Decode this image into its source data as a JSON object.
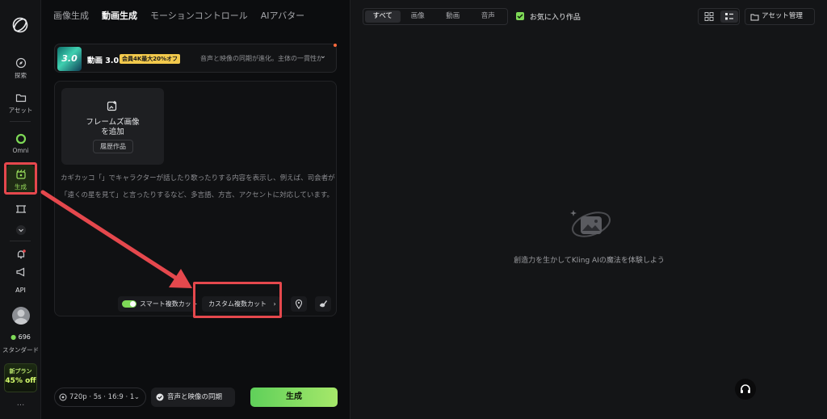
{
  "rail": {
    "items": [
      {
        "label": "探索"
      },
      {
        "label": "アセット"
      },
      {
        "label": "Omni"
      },
      {
        "label": "生成"
      },
      {
        "label": "API"
      }
    ],
    "credits": "696",
    "plan": "スタンダード",
    "promo_line1": "新プラン",
    "promo_line2": "45% off",
    "more": "..."
  },
  "top_nav": {
    "tabs": [
      "画像生成",
      "動画生成",
      "モーションコントロール",
      "AIアバター"
    ],
    "active": "動画生成"
  },
  "model": {
    "thumb_text": "3.0",
    "name": "動画 3.0",
    "badge": "会員4K最大20%オフ",
    "description": "音声と映像の同期が進化。主体の一貫性が...",
    "accent_color": "#f2c94c"
  },
  "frame": {
    "title_line1": "フレームズ画像",
    "title_line2": "を追加",
    "history_label": "履歴作品"
  },
  "prompt": {
    "placeholder": "カギカッコ「」でキャラクターが話したり歌ったりする内容を表示し、例えば、司会者が「遠くの星を見て」と言ったりするなど、多言語、方言、アクセントに対応しています。"
  },
  "controls": {
    "smart_multicut": "スマート複数カット",
    "custom_multicut": "カスタム複数カット",
    "custom_chevron": "›"
  },
  "bottom": {
    "settings": "720p · 5s · 16:9 · 1",
    "sync": "音声と映像の同期",
    "generate": "生成",
    "generate_color": "#7ed957"
  },
  "right_panel": {
    "filters": [
      "すべて",
      "画像",
      "動画",
      "音声"
    ],
    "selected_filter": "すべて",
    "favorites": "お気に入り作品",
    "asset_manage": "アセット管理",
    "empty_message": "創造力を生かしてKling AIの魔法を体験しよう"
  },
  "annotation_color": "#e5484d"
}
